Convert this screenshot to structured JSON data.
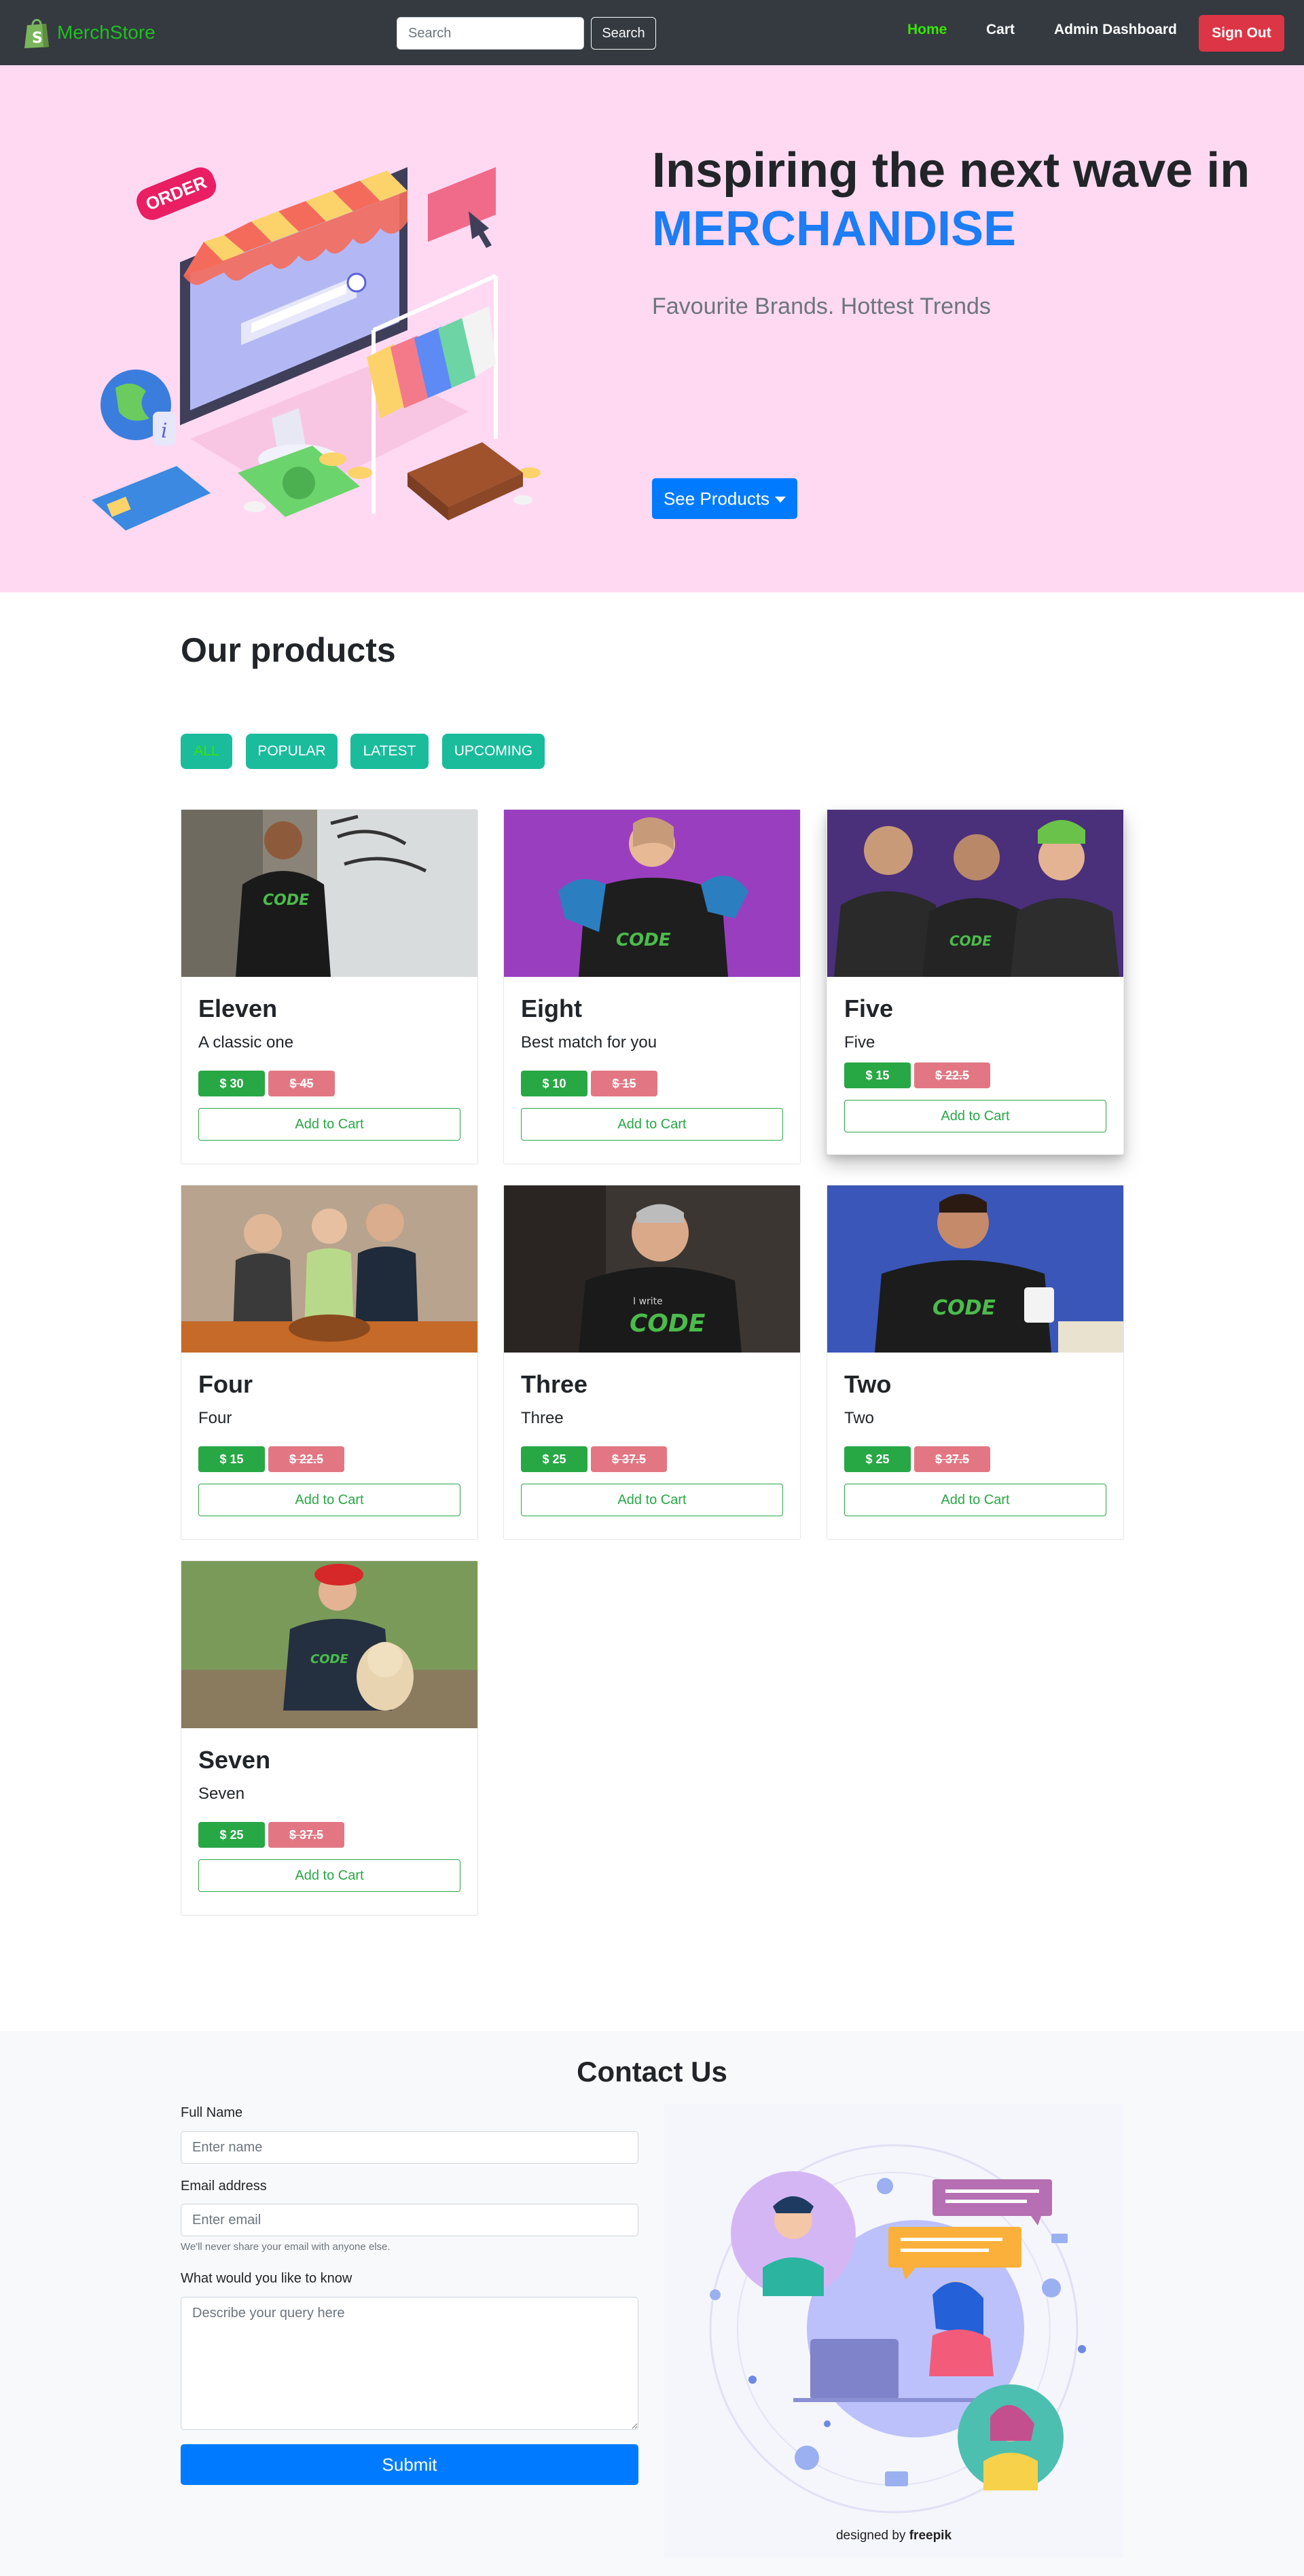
{
  "navbar": {
    "brand": "MerchStore",
    "search_placeholder": "Search",
    "search_button": "Search",
    "links": {
      "home": "Home",
      "cart": "Cart",
      "admin": "Admin Dashboard"
    },
    "sign_out": "Sign Out"
  },
  "hero": {
    "title_prefix": "Inspiring the next wave in",
    "title_accent": "MERCHANDISE",
    "subtitle": "Favourite Brands. Hottest Trends",
    "button": "See Products",
    "illustration_text": "ORDER"
  },
  "products": {
    "title": "Our products",
    "filters": [
      "ALL",
      "POPULAR",
      "LATEST",
      "UPCOMING"
    ],
    "active_filter": "ALL",
    "add_to_cart": "Add to Cart",
    "items": [
      {
        "name": "Eleven",
        "desc": "A classic one",
        "price": "$ 30",
        "old_price": "$ 45",
        "image": "man-code-tshirt-wall"
      },
      {
        "name": "Eight",
        "desc": "Best match for you",
        "price": "$ 10",
        "old_price": "$ 15",
        "image": "woman-code-tshirt-purple"
      },
      {
        "name": "Five",
        "desc": "Five",
        "price": "$ 15",
        "old_price": "$ 22.5",
        "image": "group-code-hoodies"
      },
      {
        "name": "Four",
        "desc": "Four",
        "price": "$ 15",
        "old_price": "$ 22.5",
        "image": "family-code-tshirts-dinner"
      },
      {
        "name": "Three",
        "desc": "Three",
        "price": "$ 25",
        "old_price": "$ 37.5",
        "image": "older-man-code-tshirt"
      },
      {
        "name": "Two",
        "desc": "Two",
        "price": "$ 25",
        "old_price": "$ 37.5",
        "image": "man-code-tshirt-mug"
      },
      {
        "name": "Seven",
        "desc": "Seven",
        "price": "$ 25",
        "old_price": "$ 37.5",
        "image": "woman-code-tshirt-dog"
      }
    ]
  },
  "contact": {
    "title": "Contact Us",
    "name_label": "Full Name",
    "name_placeholder": "Enter name",
    "email_label": "Email address",
    "email_placeholder": "Enter email",
    "email_hint": "We'll never share your email with anyone else.",
    "query_label": "What would you like to know",
    "query_placeholder": "Describe your query here",
    "submit": "Submit",
    "credit_prefix": "designed by",
    "credit_brand": "freepik"
  },
  "colors": {
    "navbar": "#343a40",
    "hero_bg": "#ffd9f2",
    "accent_blue": "#007bff",
    "filter_teal": "#1abc9c",
    "price_green": "#28a745",
    "price_old": "#e27783",
    "danger": "#dc3545"
  }
}
